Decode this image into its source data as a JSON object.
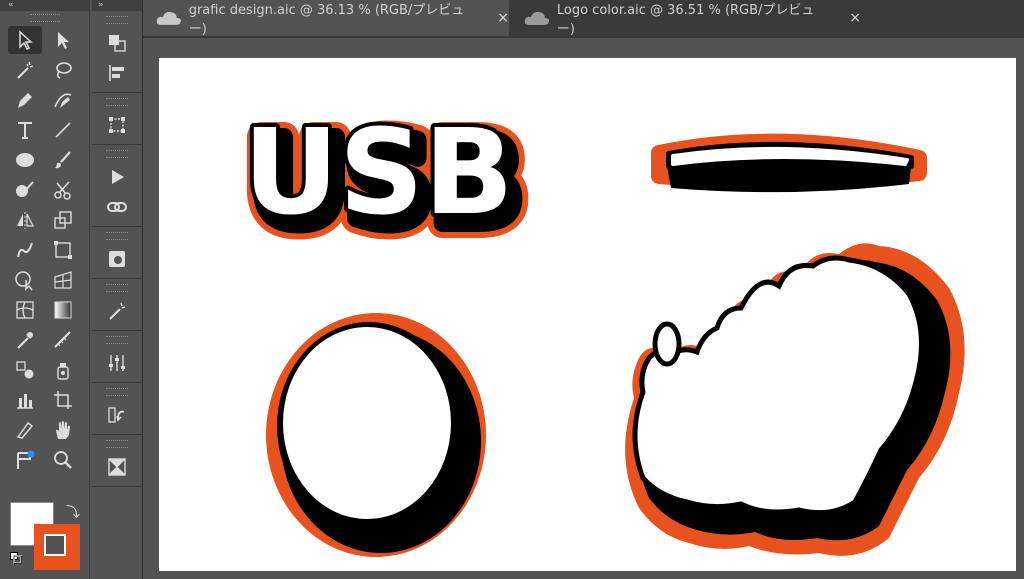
{
  "toolbar": {
    "collapse_glyph": "«",
    "tools": [
      {
        "name": "selection-tool-icon",
        "active": true
      },
      {
        "name": "direct-selection-tool-icon"
      },
      {
        "name": "magic-wand-tool-icon"
      },
      {
        "name": "lasso-tool-icon"
      },
      {
        "name": "pen-tool-icon"
      },
      {
        "name": "curvature-tool-icon"
      },
      {
        "name": "type-tool-icon"
      },
      {
        "name": "line-segment-tool-icon"
      },
      {
        "name": "ellipse-tool-icon"
      },
      {
        "name": "paintbrush-tool-icon"
      },
      {
        "name": "shaper-tool-icon"
      },
      {
        "name": "scissors-tool-icon"
      },
      {
        "name": "reflect-tool-icon"
      },
      {
        "name": "scale-tool-icon"
      },
      {
        "name": "warp-tool-icon"
      },
      {
        "name": "free-transform-tool-icon"
      },
      {
        "name": "shape-builder-tool-icon"
      },
      {
        "name": "perspective-grid-tool-icon"
      },
      {
        "name": "mesh-tool-icon"
      },
      {
        "name": "gradient-tool-icon"
      },
      {
        "name": "eyedropper-tool-icon"
      },
      {
        "name": "measure-tool-icon"
      },
      {
        "name": "blend-tool-icon"
      },
      {
        "name": "symbol-sprayer-tool-icon"
      },
      {
        "name": "column-graph-tool-icon"
      },
      {
        "name": "artboard-tool-icon"
      },
      {
        "name": "slice-tool-icon"
      },
      {
        "name": "hand-tool-icon"
      },
      {
        "name": "puppet-warp-tool-icon"
      },
      {
        "name": "zoom-tool-icon"
      }
    ],
    "fill_color": "#ffffff",
    "stroke_color": "#e8521f"
  },
  "panel": {
    "collapse_glyph": "»",
    "icons": [
      "pathfinder-icon",
      "align-icon",
      "transform-icon",
      "actions-icon",
      "links-icon",
      "image-trace-icon",
      "magic-wand-panel-icon",
      "properties-sliders-icon",
      "history-icon",
      "navigator-icon"
    ]
  },
  "tabs": [
    {
      "label": "grafic design.aic @ 36.13 % (RGB/プレビュー)",
      "active": true,
      "close": "×"
    },
    {
      "label": "Logo color.aic @ 36.51 % (RGB/プレビュー)",
      "active": false,
      "close": "×"
    }
  ],
  "artwork": {
    "text": "USB",
    "accent": "#e8521f",
    "outline": "#000000",
    "fill": "#ffffff"
  }
}
